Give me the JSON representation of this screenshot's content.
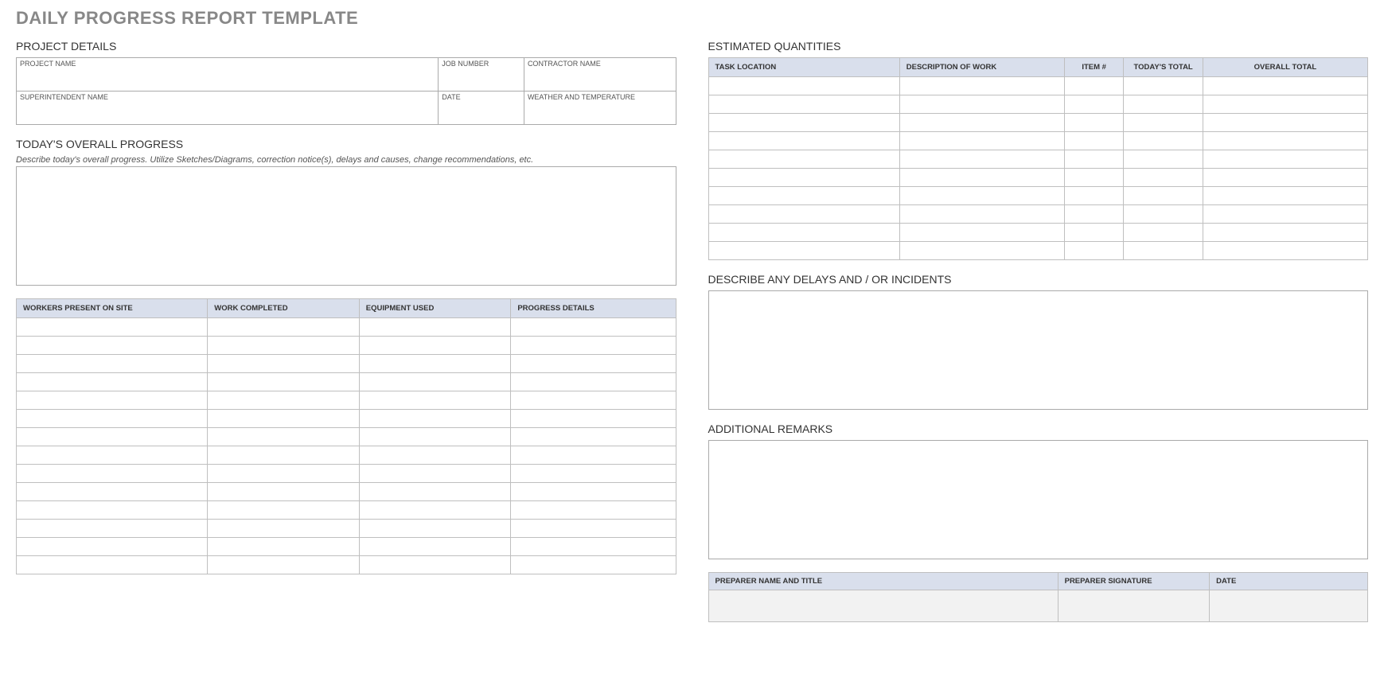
{
  "title": "DAILY PROGRESS REPORT TEMPLATE",
  "sections": {
    "project_details": "PROJECT DETAILS",
    "overall_progress": "TODAY'S OVERALL PROGRESS",
    "estimated_quantities": "ESTIMATED QUANTITIES",
    "delays": "DESCRIBE ANY DELAYS AND / OR INCIDENTS",
    "remarks": "ADDITIONAL REMARKS"
  },
  "project_details": {
    "project_name": {
      "label": "PROJECT NAME",
      "value": ""
    },
    "job_number": {
      "label": "JOB NUMBER",
      "value": ""
    },
    "contractor_name": {
      "label": "CONTRACTOR NAME",
      "value": ""
    },
    "superintendent_name": {
      "label": "SUPERINTENDENT NAME",
      "value": ""
    },
    "date": {
      "label": "DATE",
      "value": ""
    },
    "weather": {
      "label": "WEATHER AND TEMPERATURE",
      "value": ""
    }
  },
  "overall_progress": {
    "hint": "Describe today's overall progress.  Utilize Sketches/Diagrams, correction notice(s), delays and causes, change recommendations, etc.",
    "value": ""
  },
  "progress_table": {
    "headers": [
      "WORKERS PRESENT ON SITE",
      "WORK COMPLETED",
      "EQUIPMENT USED",
      "PROGRESS DETAILS"
    ],
    "rows": [
      [
        "",
        "",
        "",
        ""
      ],
      [
        "",
        "",
        "",
        ""
      ],
      [
        "",
        "",
        "",
        ""
      ],
      [
        "",
        "",
        "",
        ""
      ],
      [
        "",
        "",
        "",
        ""
      ],
      [
        "",
        "",
        "",
        ""
      ],
      [
        "",
        "",
        "",
        ""
      ],
      [
        "",
        "",
        "",
        ""
      ],
      [
        "",
        "",
        "",
        ""
      ],
      [
        "",
        "",
        "",
        ""
      ],
      [
        "",
        "",
        "",
        ""
      ],
      [
        "",
        "",
        "",
        ""
      ],
      [
        "",
        "",
        "",
        ""
      ],
      [
        "",
        "",
        "",
        ""
      ]
    ]
  },
  "quantities_table": {
    "headers": [
      "TASK LOCATION",
      "DESCRIPTION OF WORK",
      "ITEM #",
      "TODAY'S TOTAL",
      "OVERALL TOTAL"
    ],
    "rows": [
      [
        "",
        "",
        "",
        "",
        ""
      ],
      [
        "",
        "",
        "",
        "",
        ""
      ],
      [
        "",
        "",
        "",
        "",
        ""
      ],
      [
        "",
        "",
        "",
        "",
        ""
      ],
      [
        "",
        "",
        "",
        "",
        ""
      ],
      [
        "",
        "",
        "",
        "",
        ""
      ],
      [
        "",
        "",
        "",
        "",
        ""
      ],
      [
        "",
        "",
        "",
        "",
        ""
      ],
      [
        "",
        "",
        "",
        "",
        ""
      ],
      [
        "",
        "",
        "",
        "",
        ""
      ]
    ]
  },
  "delays": {
    "value": ""
  },
  "remarks": {
    "value": ""
  },
  "signature": {
    "headers": [
      "PREPARER NAME AND TITLE",
      "PREPARER SIGNATURE",
      "DATE"
    ],
    "values": [
      "",
      "",
      ""
    ]
  }
}
